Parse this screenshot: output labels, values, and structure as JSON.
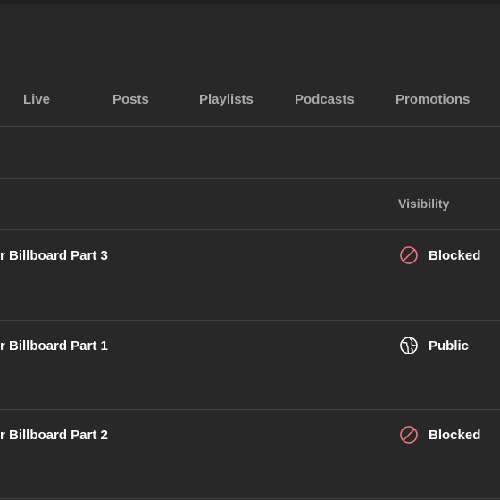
{
  "tabs": [
    {
      "label": "Live"
    },
    {
      "label": "Posts"
    },
    {
      "label": "Playlists"
    },
    {
      "label": "Podcasts"
    },
    {
      "label": "Promotions"
    }
  ],
  "table": {
    "headers": {
      "visibility": "Visibility"
    },
    "rows": [
      {
        "title": "r Billboard Part 3",
        "visibility": "Blocked",
        "visibility_icon": "blocked-icon"
      },
      {
        "title": "r Billboard Part 1",
        "visibility": "Public",
        "visibility_icon": "globe-icon"
      },
      {
        "title": "r Billboard Part 2",
        "visibility": "Blocked",
        "visibility_icon": "blocked-icon"
      }
    ]
  },
  "colors": {
    "background": "#282828",
    "divider": "#3e3e3e",
    "tab_text": "#aaaaaa",
    "blocked_icon": "#e8787c"
  }
}
